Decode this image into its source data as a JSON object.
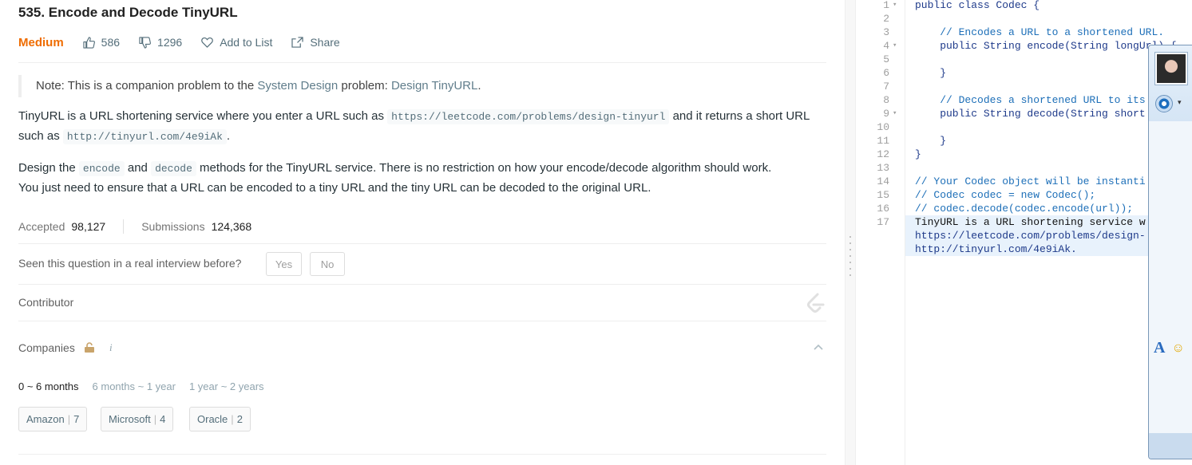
{
  "problem": {
    "title": "535. Encode and Decode TinyURL",
    "difficulty": "Medium",
    "likes": "586",
    "dislikes": "1296",
    "add_to_list": "Add to List",
    "share": "Share",
    "note_prefix": "Note: This is a companion problem to the ",
    "note_link1": "System Design",
    "note_mid": " problem: ",
    "note_link2": "Design TinyURL",
    "note_end": ".",
    "p1_a": "TinyURL is a URL shortening service where you enter a URL such as ",
    "p1_code1": "https://leetcode.com/problems/design-tinyurl",
    "p1_b": " and it returns a short URL",
    "p1_c": "such as ",
    "p1_code2": "http://tinyurl.com/4e9iAk",
    "p1_d": ".",
    "p2_a": "Design the ",
    "p2_code1": "encode",
    "p2_b": " and ",
    "p2_code2": "decode",
    "p2_c": " methods for the TinyURL service. There is no restriction on how your encode/decode algorithm should work.",
    "p2_d": "You just need to ensure that a URL can be encoded to a tiny URL and the tiny URL can be decoded to the original URL."
  },
  "stats": {
    "accepted_label": "Accepted",
    "accepted_value": "98,127",
    "submissions_label": "Submissions",
    "submissions_value": "124,368"
  },
  "interview": {
    "question": "Seen this question in a real interview before?",
    "yes": "Yes",
    "no": "No"
  },
  "contributor_label": "Contributor",
  "companies": {
    "label": "Companies",
    "info": "i",
    "tabs": [
      "0 ~ 6 months",
      "6 months ~ 1 year",
      "1 year ~ 2 years"
    ],
    "chips": [
      {
        "name": "Amazon",
        "count": "7"
      },
      {
        "name": "Microsoft",
        "count": "4"
      },
      {
        "name": "Oracle",
        "count": "2"
      }
    ]
  },
  "editor": {
    "lines": [
      {
        "n": "1",
        "fold": "▾",
        "text": "public class Codec {",
        "cls": "code"
      },
      {
        "n": "2",
        "fold": "",
        "text": "",
        "cls": "code"
      },
      {
        "n": "3",
        "fold": "",
        "text": "    // Encodes a URL to a shortened URL.",
        "cls": "cmt"
      },
      {
        "n": "4",
        "fold": "▾",
        "text": "    public String encode(String longUrl) {",
        "cls": "code"
      },
      {
        "n": "5",
        "fold": "",
        "text": "",
        "cls": "code"
      },
      {
        "n": "6",
        "fold": "",
        "text": "    }",
        "cls": "code"
      },
      {
        "n": "7",
        "fold": "",
        "text": "",
        "cls": "code"
      },
      {
        "n": "8",
        "fold": "",
        "text": "    // Decodes a shortened URL to its",
        "cls": "cmt"
      },
      {
        "n": "9",
        "fold": "▾",
        "text": "    public String decode(String short",
        "cls": "code"
      },
      {
        "n": "10",
        "fold": "",
        "text": "",
        "cls": "code"
      },
      {
        "n": "11",
        "fold": "",
        "text": "    }",
        "cls": "code"
      },
      {
        "n": "12",
        "fold": "",
        "text": "}",
        "cls": "code"
      },
      {
        "n": "13",
        "fold": "",
        "text": "",
        "cls": "code"
      },
      {
        "n": "14",
        "fold": "",
        "text": "// Your Codec object will be instanti",
        "cls": "cmt"
      },
      {
        "n": "15",
        "fold": "",
        "text": "// Codec codec = new Codec();",
        "cls": "cmt"
      },
      {
        "n": "16",
        "fold": "",
        "text": "// codec.decode(codec.encode(url));",
        "cls": "cmt"
      },
      {
        "n": "17",
        "fold": "",
        "text": "TinyURL is a URL shortening service w",
        "cls": "plain"
      },
      {
        "n": "",
        "fold": "",
        "text": "https://leetcode.com/problems/design-",
        "cls": "code"
      },
      {
        "n": "",
        "fold": "",
        "text": "http://tinyurl.com/4e9iAk.",
        "cls": "code"
      }
    ]
  },
  "chat_widget": {
    "font_icon": "A",
    "emoji_icon": "☺"
  },
  "colors": {
    "difficulty_medium": "#ef6c00",
    "link": "#607d8b",
    "selection": "#e8f2fc"
  }
}
